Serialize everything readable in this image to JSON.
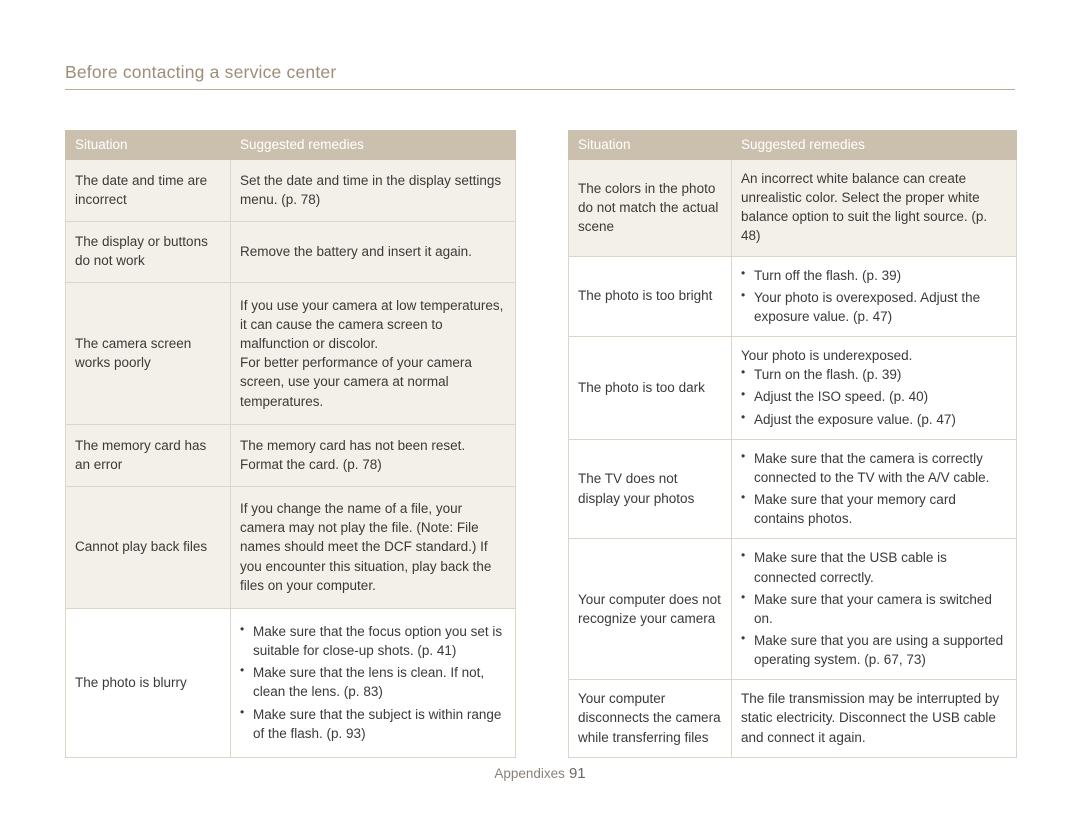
{
  "header": {
    "title": "Before contacting a service center"
  },
  "footer": {
    "label": "Appendixes",
    "page": "91"
  },
  "tables": {
    "left": {
      "headers": [
        "Situation",
        "Suggested remedies"
      ],
      "rows": [
        {
          "shaded": true,
          "situation": "The date and time are incorrect",
          "remedy_type": "text",
          "remedy": "Set the date and time in the display settings menu. (p. 78)"
        },
        {
          "shaded": true,
          "situation": "The display or buttons do not work",
          "remedy_type": "text",
          "remedy": "Remove the battery and insert it again."
        },
        {
          "shaded": true,
          "situation": "The camera screen works poorly",
          "remedy_type": "paragraphs",
          "paragraphs": [
            "If you use your camera at low temperatures, it can cause the camera screen to malfunction or discolor.",
            "For better performance of your camera screen, use your camera at normal temperatures."
          ]
        },
        {
          "shaded": true,
          "situation": "The memory card has an error",
          "remedy_type": "text",
          "remedy": "The memory card has not been reset. Format the card. (p. 78)"
        },
        {
          "shaded": true,
          "situation": "Cannot play back files",
          "remedy_type": "text",
          "remedy": "If you change the name of a file, your camera may not play the file. (Note: File names should meet the DCF standard.) If you encounter this situation, play back the files on your computer."
        },
        {
          "shaded": false,
          "situation": "The photo is blurry",
          "remedy_type": "bullets",
          "bullets": [
            "Make sure that the focus option you set is suitable for close-up shots. (p. 41)",
            "Make sure that the lens is clean. If not, clean the lens. (p. 83)",
            "Make sure that the subject is within range of the flash. (p. 93)"
          ]
        }
      ]
    },
    "right": {
      "headers": [
        "Situation",
        "Suggested remedies"
      ],
      "rows": [
        {
          "shaded": true,
          "situation": "The colors in the photo do not match the actual scene",
          "remedy_type": "text",
          "remedy": "An incorrect white balance can create unrealistic color. Select the proper white balance option to suit the light source. (p. 48)"
        },
        {
          "shaded": false,
          "situation": "The photo is too bright",
          "remedy_type": "bullets",
          "bullets": [
            "Turn off the flash. (p. 39)",
            "Your photo is overexposed. Adjust the exposure value. (p. 47)"
          ]
        },
        {
          "shaded": false,
          "situation": "The photo is too dark",
          "remedy_type": "text_then_bullets",
          "lead": "Your photo is underexposed.",
          "bullets": [
            "Turn on the flash. (p. 39)",
            "Adjust the ISO speed. (p. 40)",
            "Adjust the exposure value. (p. 47)"
          ]
        },
        {
          "shaded": false,
          "situation": "The TV does not display your photos",
          "remedy_type": "bullets",
          "bullets": [
            "Make sure that the camera is correctly connected to the TV with the A/V cable.",
            "Make sure that your memory card contains photos."
          ]
        },
        {
          "shaded": false,
          "situation": "Your computer does not recognize your camera",
          "remedy_type": "bullets",
          "bullets": [
            "Make sure that the USB cable is connected correctly.",
            "Make sure that your camera is switched on.",
            "Make sure that you are using a supported operating system. (p. 67, 73)"
          ]
        },
        {
          "shaded": false,
          "situation": "Your computer disconnects the camera while transferring files",
          "remedy_type": "text",
          "remedy": "The file transmission may be interrupted by static electricity. Disconnect the USB cable and connect it again."
        }
      ]
    }
  }
}
